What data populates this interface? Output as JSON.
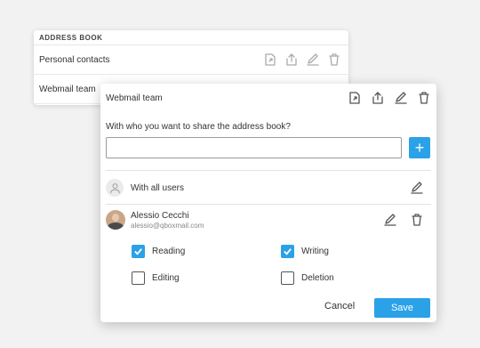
{
  "address_book": {
    "header": "ADDRESS BOOK",
    "rows": [
      {
        "label": "Personal contacts"
      },
      {
        "label": "Webmail team"
      }
    ]
  },
  "share_panel": {
    "title": "Webmail team",
    "question": "With who you want to share the address book?",
    "input_value": "",
    "input_placeholder": "",
    "add_button": "+",
    "all_users_label": "With all users",
    "user": {
      "name": "Alessio Cecchi",
      "email": "alessio@qboxmail.com"
    },
    "permissions": [
      {
        "label": "Reading",
        "checked": true
      },
      {
        "label": "Writing",
        "checked": true
      },
      {
        "label": "Editing",
        "checked": false
      },
      {
        "label": "Deletion",
        "checked": false
      }
    ],
    "cancel_label": "Cancel",
    "save_label": "Save"
  },
  "colors": {
    "accent": "#2ba1e8",
    "background": "#f2f2f2"
  },
  "icons": [
    "share-book-icon",
    "share-icon",
    "edit-icon",
    "trash-icon",
    "user-icon",
    "check-icon"
  ]
}
